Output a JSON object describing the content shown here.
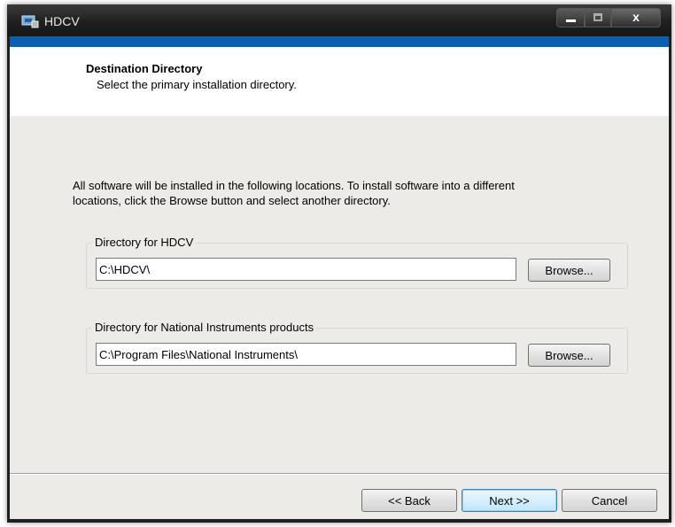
{
  "window": {
    "title": "HDCV"
  },
  "title_bar": {
    "minimize": "minimize",
    "maximize": "maximize",
    "close": "x"
  },
  "header": {
    "title": "Destination Directory",
    "subtitle": "Select the primary installation directory."
  },
  "description": "All software will be installed in the following locations. To install software into a different locations, click the Browse button and select another directory.",
  "directories": [
    {
      "label": "Directory for HDCV",
      "value": "C:\\HDCV\\",
      "browse_label": "Browse..."
    },
    {
      "label": "Directory for National Instruments products",
      "value": "C:\\Program Files\\National Instruments\\",
      "browse_label": "Browse..."
    }
  ],
  "footer": {
    "back_label": "<< Back",
    "next_label": "Next >>",
    "cancel_label": "Cancel"
  },
  "colors": {
    "accent_bar": "#0b5fb0",
    "title_bar": "#1e1e1e",
    "body_bg": "#ecebe8"
  },
  "icons": {
    "app": "installer-app-icon"
  }
}
